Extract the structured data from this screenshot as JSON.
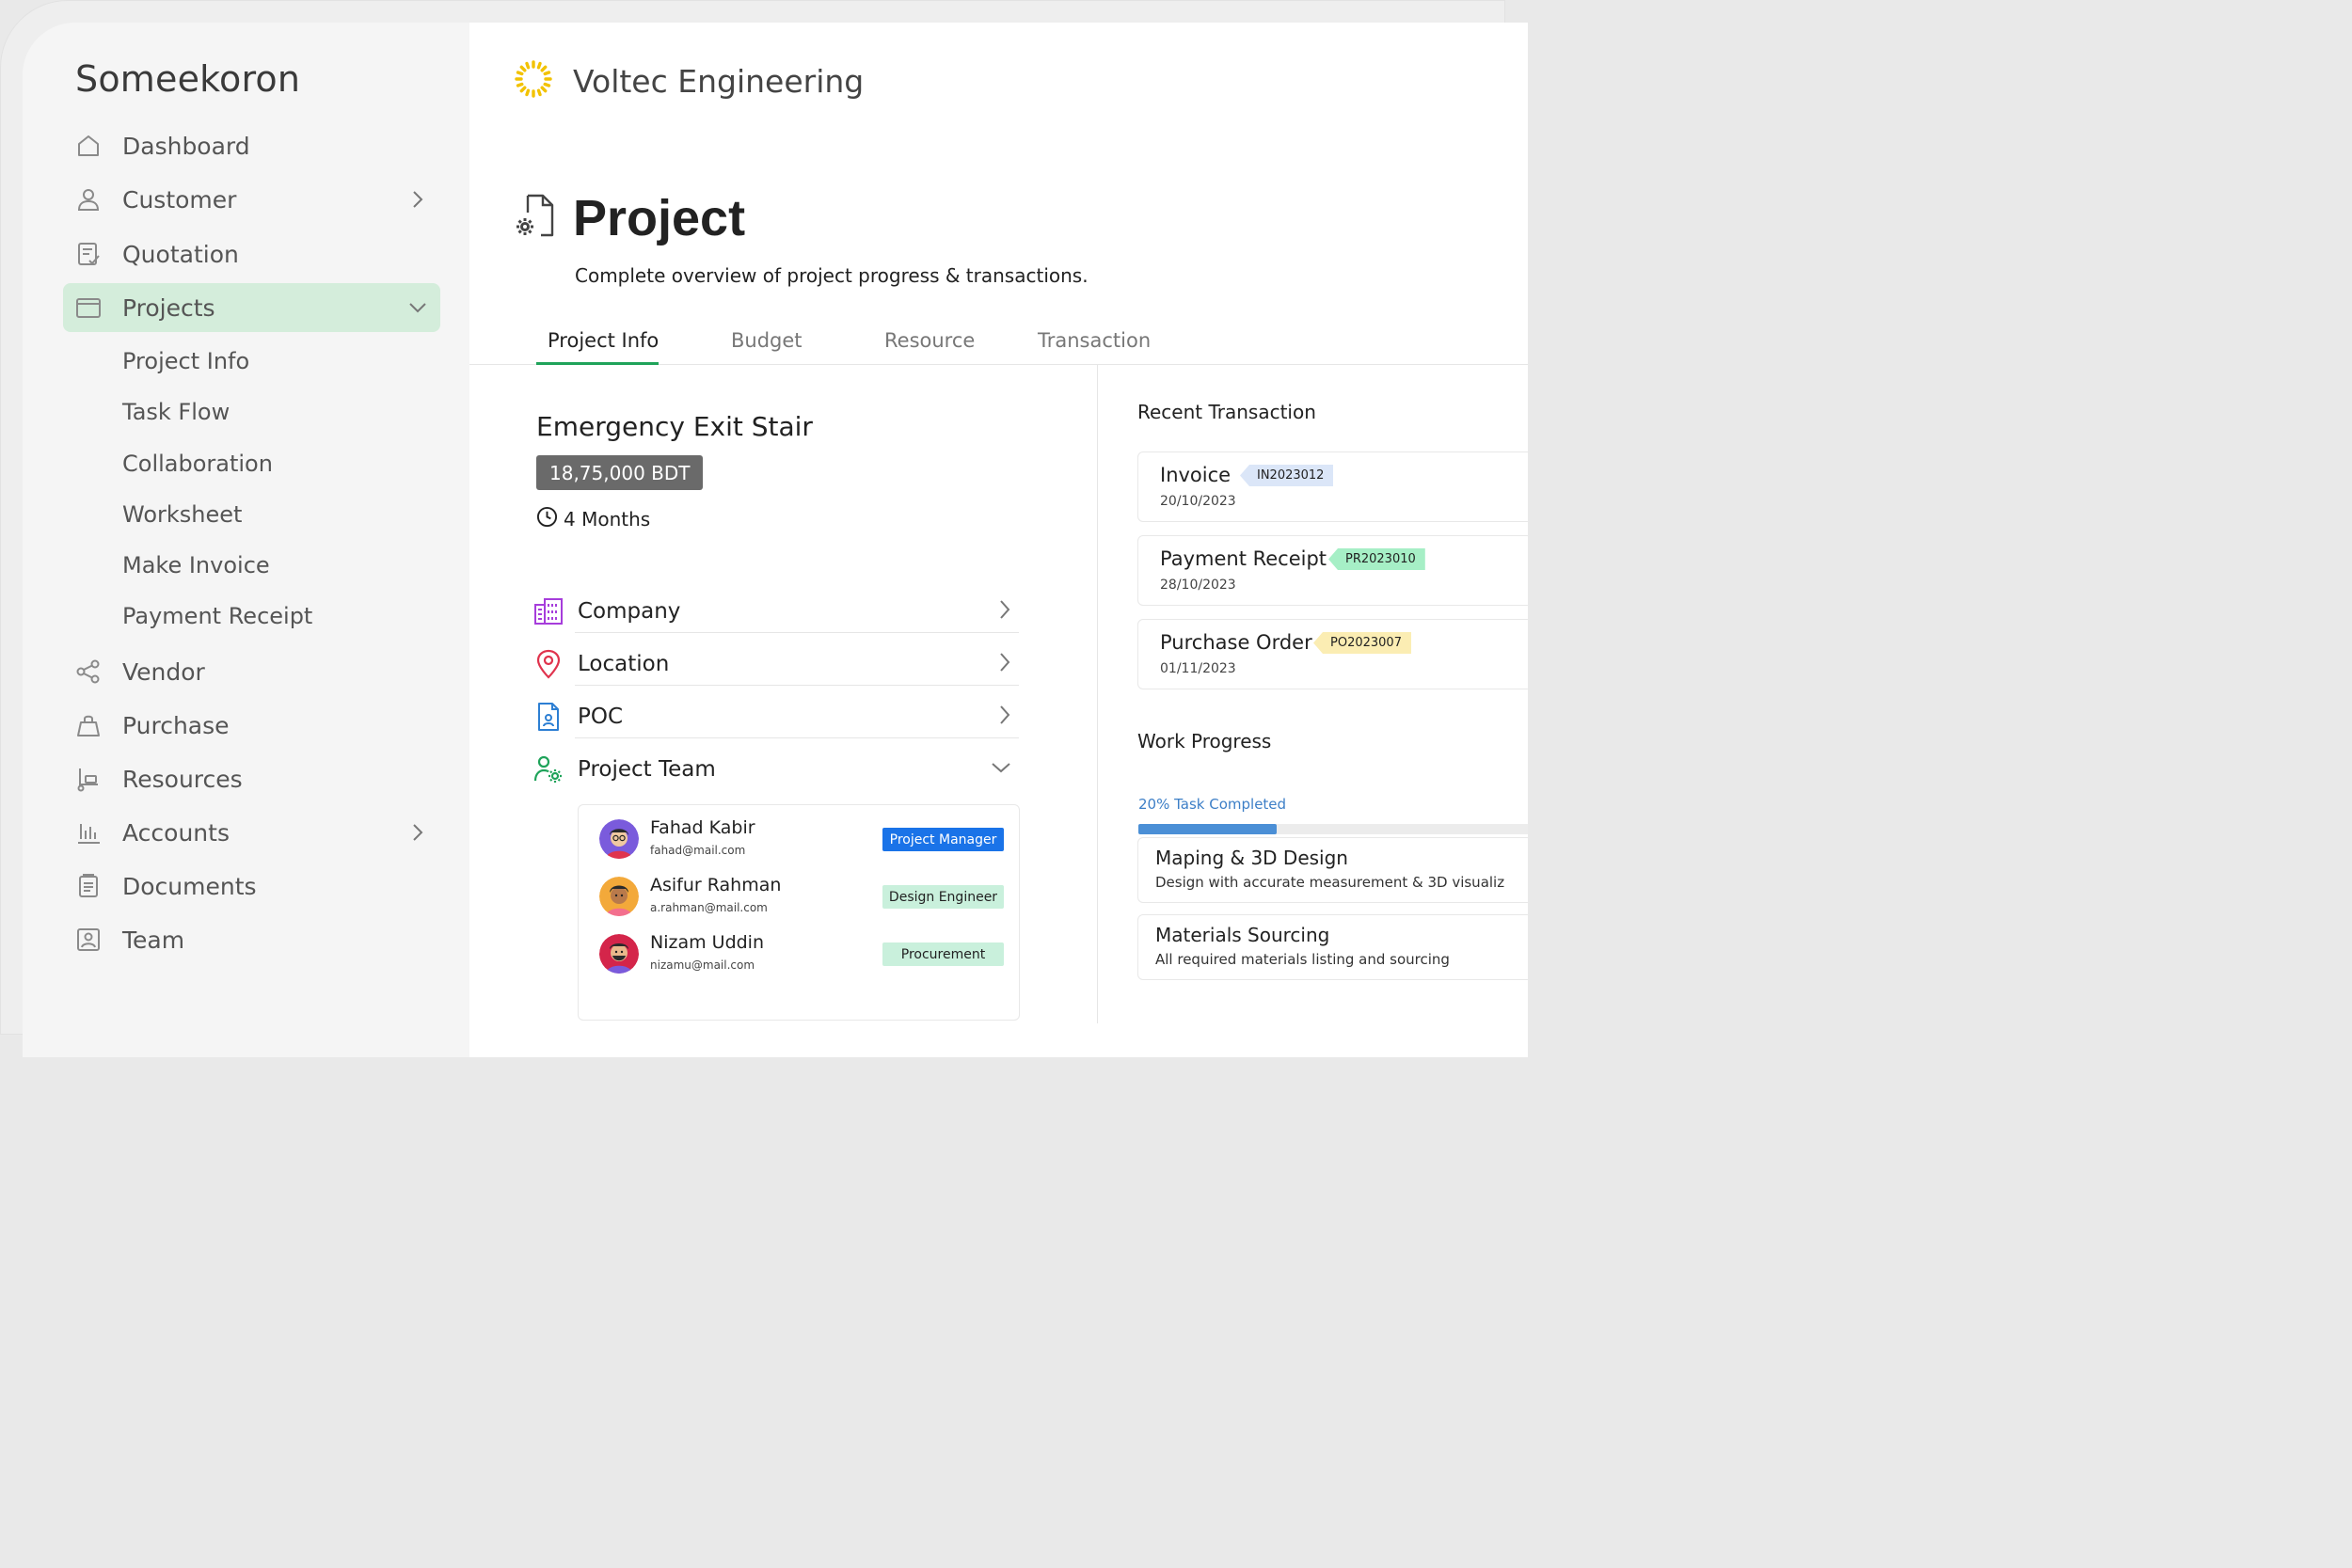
{
  "app": {
    "brand": "Someekoron"
  },
  "sidebar": {
    "items": [
      {
        "label": "Dashboard",
        "icon": "home-icon"
      },
      {
        "label": "Customer",
        "icon": "user-icon"
      },
      {
        "label": "Quotation",
        "icon": "quotation-icon"
      },
      {
        "label": "Projects",
        "icon": "folder-icon"
      },
      {
        "label": "Vendor",
        "icon": "share-icon"
      },
      {
        "label": "Purchase",
        "icon": "bag-icon"
      },
      {
        "label": "Resources",
        "icon": "trolley-icon"
      },
      {
        "label": "Accounts",
        "icon": "bar-chart-icon"
      },
      {
        "label": "Documents",
        "icon": "document-icon"
      },
      {
        "label": "Team",
        "icon": "id-card-icon"
      }
    ],
    "sub_items": [
      "Project Info",
      "Task Flow",
      "Collaboration",
      "Worksheet",
      "Make Invoice",
      "Payment Receipt"
    ]
  },
  "header": {
    "company": "Voltec Engineering"
  },
  "page": {
    "title": "Project",
    "subtitle": "Complete overview of project progress & transactions."
  },
  "tabs": [
    "Project Info",
    "Budget",
    "Resource",
    "Transaction"
  ],
  "project": {
    "name": "Emergency Exit Stair",
    "budget": "18,75,000 BDT",
    "duration": "4 Months",
    "sections": [
      "Company",
      "Location",
      "POC",
      "Project Team"
    ],
    "team": [
      {
        "name": "Fahad Kabir",
        "email": "fahad@mail.com",
        "role": "Project Manager"
      },
      {
        "name": "Asifur Rahman",
        "email": "a.rahman@mail.com",
        "role": "Design Engineer"
      },
      {
        "name": "Nizam Uddin",
        "email": "nizamu@mail.com",
        "role": "Procurement"
      }
    ]
  },
  "recent_transaction": {
    "title": "Recent Transaction",
    "items": [
      {
        "title": "Invoice",
        "code": "IN2023012",
        "date": "20/10/2023",
        "tag_color": "#dbe6f8"
      },
      {
        "title": "Payment Receipt",
        "code": "PR2023010",
        "date": "28/10/2023",
        "tag_color": "#a6efc6"
      },
      {
        "title": "Purchase Order",
        "code": "PO2023007",
        "date": "01/11/2023",
        "tag_color": "#fbedb3"
      }
    ]
  },
  "work_progress": {
    "title": "Work Progress",
    "completed_text": "20% Task Completed",
    "completed_fraction": 0.35,
    "tasks": [
      {
        "title": "Maping & 3D Design",
        "desc": "Design with accurate measurement & 3D visualiz"
      },
      {
        "title": "Materials Sourcing",
        "desc": "All required materials listing and sourcing"
      }
    ]
  },
  "colors": {
    "accent_green": "#1fa35a",
    "active_nav_bg": "#d4eddb",
    "progress_blue": "#4b8fd6",
    "role_primary": "#1a73e8",
    "role_secondary": "#c9f0dc"
  }
}
